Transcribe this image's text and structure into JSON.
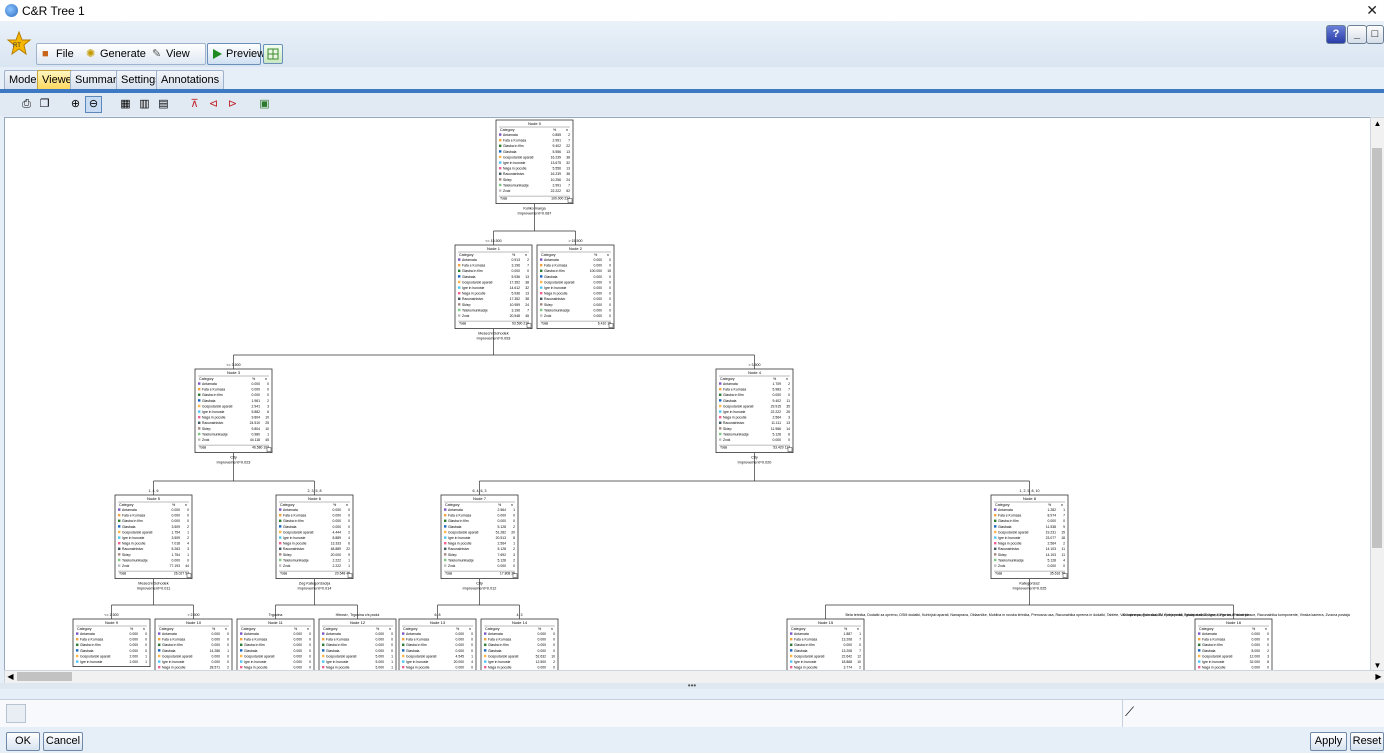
{
  "window": {
    "title": "C&R Tree 1"
  },
  "toolbar": {
    "file_label": "File",
    "generate_label": "Generate",
    "view_label": "View",
    "preview_label": "Preview",
    "help_label": "?",
    "minimize_label": "_",
    "maximize_label": "□"
  },
  "tabs": [
    "Model",
    "Viewer",
    "Summary",
    "Settings",
    "Annotations"
  ],
  "active_tab": "Viewer",
  "footer": {
    "ok_label": "OK",
    "cancel_label": "Cancel",
    "apply_label": "Apply",
    "reset_label": "Reset"
  },
  "tree": {
    "header_category": "Category",
    "header_pct": "%",
    "header_n": "n",
    "total_label": "Total",
    "categories": [
      "Antarnata",
      "Fata e Kurnasa",
      "Glasba in film",
      "Glasbala",
      "Gospodarski aparati",
      "Igre in hunoste",
      "Naga in pocutie",
      "Racunalnistvo",
      "Sklep",
      "Telekomunikacije",
      "Zvok"
    ],
    "nodes": [
      {
        "id": "Node 0",
        "total": "100.000  234",
        "rows": [
          "0.855 2",
          "2.991 7",
          "9.402 22",
          "5.556 13",
          "16.239 38",
          "13.675 32",
          "5.556 13",
          "16.239 38",
          "10.256 24",
          "2.991 7",
          "22.222 52"
        ]
      },
      {
        "id": "Node 1",
        "total": "93.590  219",
        "rows": [
          "0.913 2",
          "3.196 7",
          "0.000 0",
          "5.936 13",
          "17.352 38",
          "14.612 32",
          "5.936 13",
          "17.352 38",
          "10.959 24",
          "3.196 7",
          "20.548 45"
        ]
      },
      {
        "id": "Node 2",
        "total": "6.410  15",
        "rows": [
          "0.000 0",
          "0.000 0",
          "100.000 15",
          "0.000 0",
          "0.000 0",
          "0.000 0",
          "0.000 0",
          "0.000 0",
          "0.000 0",
          "0.000 0",
          "0.000 0"
        ]
      },
      {
        "id": "Node 3",
        "total": "46.580  102",
        "rows": [
          "0.000 0",
          "0.000 0",
          "0.000 0",
          "1.961 2",
          "2.941 3",
          "5.882 6",
          "9.804 10",
          "24.510 25",
          "9.804 10",
          "0.980 1",
          "44.118 45"
        ]
      },
      {
        "id": "Node 4",
        "total": "53.420  117",
        "rows": [
          "1.709 2",
          "5.983 7",
          "0.000 0",
          "9.402 11",
          "29.915 35",
          "22.222 26",
          "2.564 3",
          "11.111 13",
          "11.966 14",
          "5.128 6",
          "0.000 0"
        ]
      },
      {
        "id": "Node 5",
        "total": "26.027  57",
        "rows": [
          "0.000 0",
          "0.000 0",
          "0.000 0",
          "3.509 2",
          "1.754 1",
          "3.509 2",
          "7.018 4",
          "5.263 3",
          "1.754 1",
          "0.000 0",
          "77.193 44"
        ]
      },
      {
        "id": "Node 6",
        "total": "20.548  45",
        "rows": [
          "0.000 0",
          "0.000 0",
          "0.000 0",
          "0.000 0",
          "4.444 2",
          "8.889 4",
          "13.333 6",
          "48.889 22",
          "20.000 9",
          "2.222 1",
          "2.222 1"
        ]
      },
      {
        "id": "Node 7",
        "total": "17.808  39",
        "rows": [
          "2.564 1",
          "0.000 0",
          "0.000 0",
          "5.128 2",
          "51.282 20",
          "20.513 8",
          "2.564 1",
          "5.128 2",
          "7.692 3",
          "5.128 2",
          "0.000 0"
        ]
      },
      {
        "id": "Node 8",
        "total": "35.616  78",
        "rows": [
          "1.282 1",
          "8.974 7",
          "0.000 0",
          "11.538 9",
          "19.231 15",
          "23.077 18",
          "2.564 2",
          "14.103 11",
          "14.103 11",
          "5.128 4",
          "0.000 0"
        ]
      },
      {
        "id": "Node 9",
        "total": "",
        "rows": [
          "0.000 0",
          "0.000 0",
          "0.000 0",
          "0.000 0",
          "2.000 1",
          "2.000 1"
        ]
      },
      {
        "id": "Node 10",
        "total": "",
        "rows": [
          "0.000 0",
          "0.000 0",
          "0.000 0",
          "14.286 1",
          "0.000 0",
          "0.000 0",
          "28.571 2"
        ]
      },
      {
        "id": "Node 11",
        "total": "",
        "rows": [
          "0.000 0",
          "0.000 0",
          "0.000 0",
          "0.000 0",
          "0.000 0",
          "0.000 0",
          "0.000 0"
        ]
      },
      {
        "id": "Node 12",
        "total": "",
        "rows": [
          "0.000 0",
          "0.000 0",
          "0.000 0",
          "0.000 0",
          "5.000 1",
          "5.000 1",
          "5.000 1"
        ]
      },
      {
        "id": "Node 13",
        "total": "",
        "rows": [
          "0.000 0",
          "0.000 0",
          "0.000 0",
          "0.000 0",
          "4.545 1",
          "20.000 4",
          "0.000 0"
        ]
      },
      {
        "id": "Node 14",
        "total": "",
        "rows": [
          "0.000 0",
          "0.000 0",
          "0.000 0",
          "0.000 0",
          "52.632 10",
          "12.500 2",
          "0.000 0"
        ]
      },
      {
        "id": "Node 15",
        "total": "",
        "rows": [
          "1.887 1",
          "13.208 7",
          "0.000 0",
          "13.208 7",
          "22.642 12",
          "18.868 10",
          "3.774 2"
        ]
      },
      {
        "id": "Node 16",
        "total": "",
        "rows": [
          "0.000 0",
          "0.000 0",
          "0.000 0",
          "8.000 2",
          "12.000 3",
          "32.000 8",
          "0.000 0"
        ]
      }
    ],
    "splits": [
      {
        "node": "Node 0",
        "variable": "Koliko marga",
        "improvement": "Improvement=0.087",
        "left": "<= 15.500",
        "right": "> 15.500"
      },
      {
        "node": "Node 1",
        "variable": "Mesecni Dohodek",
        "improvement": "Improvement=0.093",
        "left": "<= 3.500",
        "right": "> 3.500"
      },
      {
        "node": "Node 3",
        "variable": "City",
        "improvement": "Improvement=0.023",
        "left": "1, 4, 6",
        "right": "2, 3, 5, 8"
      },
      {
        "node": "Node 4",
        "variable": "City",
        "improvement": "Improvement=0.020",
        "left": "6, 4, 6, 3",
        "right": "1, 2, 5, 8, 10"
      },
      {
        "node": "Node 5",
        "variable": "Mesecni Dohodek",
        "improvement": "Improvement=0.011",
        "left": "<= 2.500",
        "right": "> 2.500"
      },
      {
        "node": "Node 6",
        "variable": "Zeg Kategorizacija",
        "improvement": "Improvement=0.014",
        "left": "Trgovina",
        "right": "Hitrost>, Trgovina v/s podul"
      },
      {
        "node": "Node 7",
        "variable": "City",
        "improvement": "Improvement=0.012",
        "left": "6, 8",
        "right": "4, 3"
      },
      {
        "node": "Node 8",
        "variable": "Kategoriza2",
        "improvement": "Improvement=0.025",
        "left": "Bela tehnika, Dodatki za opremo, DSM dodatki, Kuhinjski aparati, Nanaprava, Oblaznilke, Mobilna in rocska tehnika, Prenosna usa, Racunalnika oprema in dodatki, Tablete, Varnostna programska, TV sprejemniki, Fotoaparati, Zabavna, Ferrari in druzinke",
        "right": "DJ oprema, Foto dodatki, Fotoaparati, Igralni dodatki, Igre, Nega las, Pralne plosce, Racunalnika komponente, Vinska kamera, Zvocna postaja"
      }
    ]
  }
}
